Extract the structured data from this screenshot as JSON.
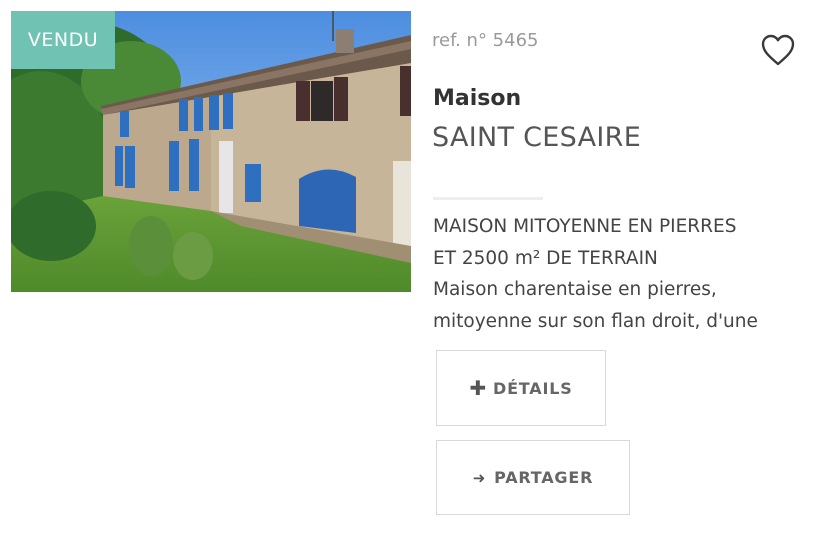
{
  "listing": {
    "status_badge": "VENDU",
    "reference": "ref. n° 5465",
    "property_type": "Maison",
    "city": "SAINT CESAIRE",
    "description_lines": [
      "MAISON MITOYENNE EN PIERRES",
      "ET 2500 m² DE TERRAIN",
      "Maison charentaise en pierres,",
      "mitoyenne sur son flan droit, d'une"
    ],
    "photo_icon": "house-photo"
  },
  "actions": {
    "details_icon": "plus-icon",
    "details_label": "DÉTAILS",
    "share_icon": "arrow-right-icon",
    "share_label": "PARTAGER",
    "favorite_icon": "heart-icon"
  },
  "colors": {
    "badge": "#70c2b3",
    "shutters": "#2f6fc0",
    "text": "#444444"
  }
}
